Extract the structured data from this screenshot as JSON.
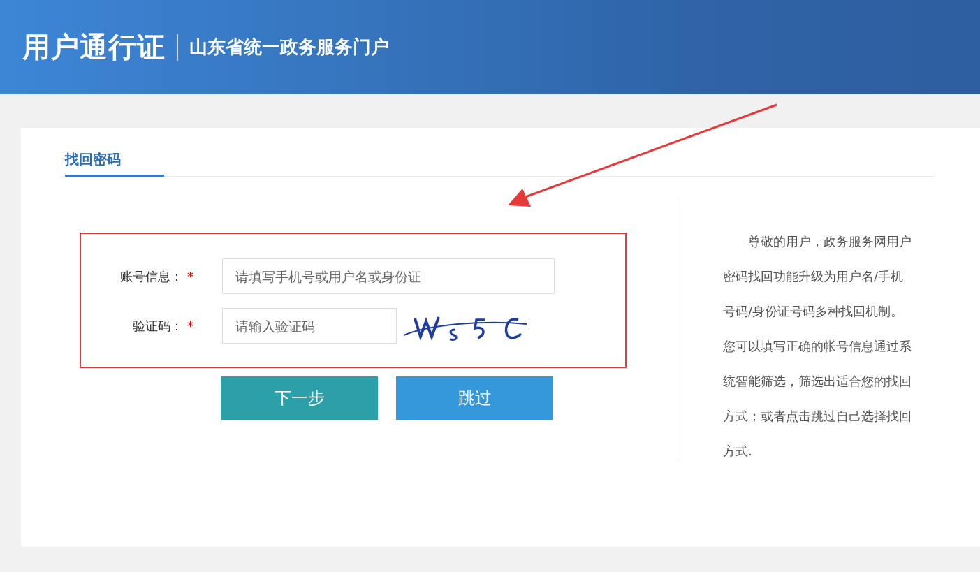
{
  "header": {
    "logo": "用户通行证",
    "portal": "山东省统一政务服务门户"
  },
  "tabs": [
    {
      "label": "找回密码",
      "selected": true
    }
  ],
  "form": {
    "fields": [
      {
        "label": "账号信息：",
        "required_mark": "*",
        "placeholder": "请填写手机号或用户名或身份证",
        "kind": "text"
      },
      {
        "label": "验证码：",
        "required_mark": "*",
        "placeholder": "请输入验证码",
        "kind": "captcha"
      }
    ],
    "buttons": [
      {
        "label": "下一步",
        "kind": "primary"
      },
      {
        "label": "跳过",
        "kind": "secondary"
      }
    ]
  },
  "notice": "尊敬的用户，政务服务网用户密码找回功能升级为用户名/手机号码/身份证号码多种找回机制。您可以填写正确的帐号信息通过系统智能筛选，筛选出适合您的找回方式；或者点击跳过自己选择找回方式."
}
